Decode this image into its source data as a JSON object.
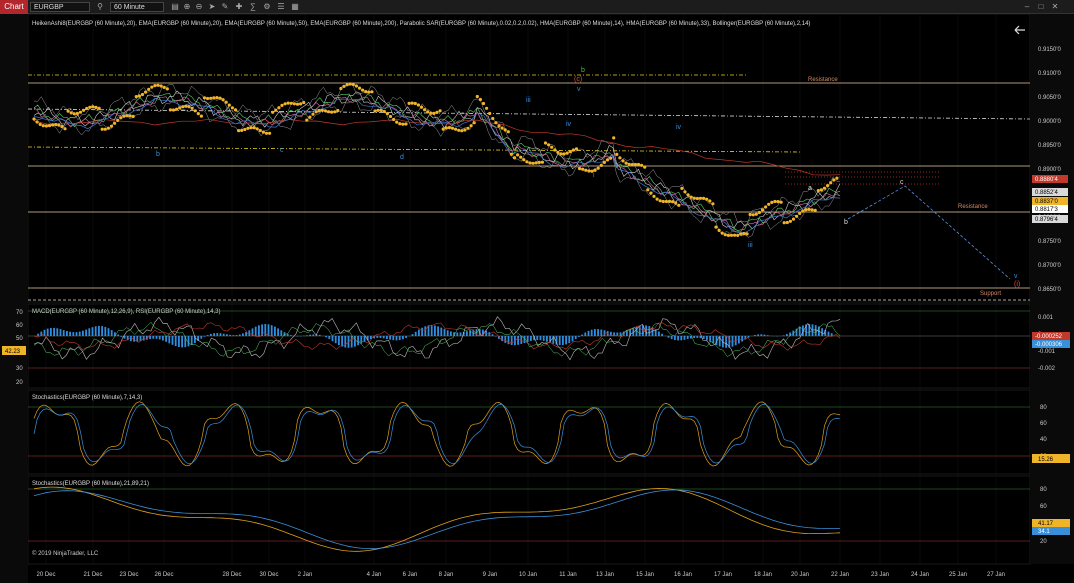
{
  "toolbar": {
    "chart_tab": "Chart",
    "instrument": "EURGBP",
    "interval": "60 Minute",
    "side_label": "F"
  },
  "panels": {
    "price": {
      "title": "HeikenAshi8(EURGBP (60 Minute),20), EMA(EURGBP (60 Minute),20), EMA(EURGBP (60 Minute),50), EMA(EURGBP (60 Minute),200), Parabolic SAR(EURGBP (60 Minute),0.02,0.2,0.02), HMA(EURGBP (60 Minute),14), HMA(EURGBP (60 Minute),33), Bollinger(EURGBP (60 Minute),2,14)",
      "y_ticks": [
        "0.9150'0",
        "0.9100'0",
        "0.9050'0",
        "0.9000'0",
        "0.8950'0",
        "0.8900'0",
        "0.8850'0",
        "0.8800'0",
        "0.8750'0",
        "0.8700'0",
        "0.8650'0"
      ],
      "price_tags": [
        {
          "text": "0.8880'4",
          "bg": "#c0392b",
          "fg": "#ffffff"
        },
        {
          "text": "0.8852'4",
          "bg": "#d9d9d9",
          "fg": "#000000"
        },
        {
          "text": "0.8837'0",
          "bg": "#f0b429",
          "fg": "#000000"
        },
        {
          "text": "0.8817'3",
          "bg": "#ffffff",
          "fg": "#000000"
        },
        {
          "text": "0.8796'4",
          "bg": "#d9d9d9",
          "fg": "#000000"
        }
      ],
      "labels": {
        "resistance_upper": "Resistance",
        "resistance_lower": "Resistance",
        "support": "Support"
      },
      "waves": {
        "b1": "b",
        "c1": "c",
        "d1": "d",
        "iii_top": "iii",
        "iv1": "iv",
        "v1": "v",
        "b_green": "b",
        "c_red": "(c)",
        "i": "i",
        "iii": "iii",
        "iv2": "iv",
        "a": "a",
        "b2": "b",
        "c2": "c",
        "v2": "v",
        "v_paren": "(i)"
      }
    },
    "macd": {
      "title": "MACD(EURGBP (60 Minute),12,26,9), RSI(EURGBP (60 Minute),14,3)",
      "left_ticks": [
        "70",
        "60",
        "50",
        "40",
        "30",
        "20"
      ],
      "left_tag": "42.23",
      "right_ticks": [
        "0.001",
        "0",
        "-0.001",
        "-0.002"
      ],
      "tag_red": "-0.000252",
      "tag_blue": "-0.000306"
    },
    "stoch1": {
      "title": "Stochastics(EURGBP (60 Minute),7,14,3)",
      "y_ticks": [
        "80",
        "60",
        "40",
        "20"
      ],
      "tag": "15.26"
    },
    "stoch2": {
      "title": "Stochastics(EURGBP (60 Minute),21,89,21)",
      "y_ticks": [
        "80",
        "60",
        "40",
        "20"
      ],
      "tag_orange": "41.17",
      "tag_blue": "34.1",
      "copyright": "© 2019 NinjaTrader, LLC"
    }
  },
  "x_axis": [
    "20 Dec",
    "21 Dec",
    "23 Dec",
    "26 Dec",
    "28 Dec",
    "30 Dec",
    "2 Jan",
    "4 Jan",
    "6 Jan",
    "8 Jan",
    "9 Jan",
    "10 Jan",
    "11 Jan",
    "13 Jan",
    "15 Jan",
    "16 Jan",
    "17 Jan",
    "18 Jan",
    "20 Jan",
    "22 Jan",
    "23 Jan",
    "24 Jan",
    "25 Jan",
    "27 Jan"
  ],
  "colors": {
    "background": "#000000",
    "grid": "#1a1a1a",
    "sar": "#f0b429",
    "ema_red": "#c0392b",
    "ema_blue": "#3a7bd5",
    "macd_hist": "#2f8ee0",
    "stoch_orange": "#e1a21a",
    "stoch_blue": "#3a8fd9",
    "level_red": "#b03a3a",
    "level_green": "#3a8a3a"
  }
}
